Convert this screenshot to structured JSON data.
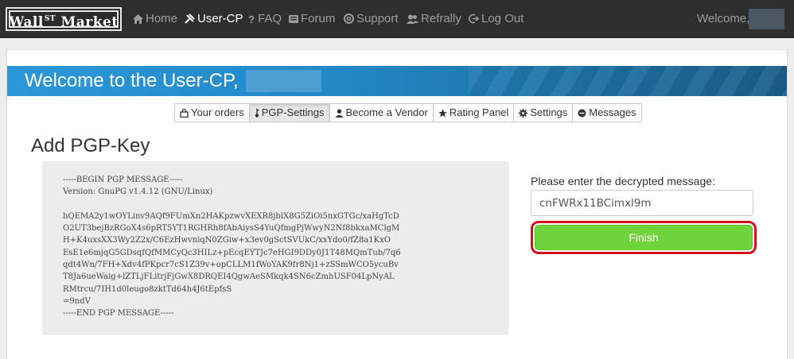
{
  "brand": {
    "main": "Wall",
    "sup": "ST",
    "rest": " Market"
  },
  "nav": {
    "items": [
      {
        "label": "Home",
        "icon": "home-icon"
      },
      {
        "label": "User-CP",
        "icon": "wrench-icon"
      },
      {
        "label": "FAQ",
        "icon": "question-icon"
      },
      {
        "label": "Forum",
        "icon": "forum-icon"
      },
      {
        "label": "Support",
        "icon": "lifebuoy-icon"
      },
      {
        "label": "Refrally",
        "icon": "users-icon"
      },
      {
        "label": "Log Out",
        "icon": "logout-icon"
      }
    ],
    "welcome": "Welcome,"
  },
  "banner": {
    "title": "Welcome to the User-CP,"
  },
  "tabs": [
    {
      "label": "Your orders",
      "icon": "shopping-bag-icon"
    },
    {
      "label": "PGP-Settings",
      "icon": "key-icon"
    },
    {
      "label": "Become a Vendor",
      "icon": "user-icon"
    },
    {
      "label": "Rating Panel",
      "icon": "star-icon"
    },
    {
      "label": "Settings",
      "icon": "gear-icon"
    },
    {
      "label": "Messages",
      "icon": "message-icon"
    }
  ],
  "page": {
    "heading": "Add PGP-Key"
  },
  "pgp_message": [
    "-----BEGIN PGP MESSAGE-----",
    "Version: GnuPG v1.4.12 (GNU/Linux)",
    "",
    "hQEMA2y1wOYLinv9AQf9FUmXn2HAKpzwvXEXR8jblX8G5ZiOi5nxGTGc/xaHgTcD",
    "O2UT3bejBzRGoX4s6pRT5YT1RGHRh8fAbAiysS4YuQfmgPjWwyN2Nf8bkxaMClgM",
    "H+K4uxsXX3Wy2Z2x/C6EzHwvniqN0ZGiw+x3ev0gSctSVUkC/xxYdo0/fZ8a1KxO",
    "EsE1e6mjqG5GDsqfQfMMCyQc3HILz+pEcqEYTJc7eHGI9DDy0J1T48MQmTub/7q6",
    "qdt4Wn/7FH+Xdv4fPKpcr7cS1Z39v+opCLLM1fWoYAK9fr8Nj1+zSSmWCO5ycuBv",
    "T8Ja6ueWaig+lZTLjFLitrjFjGwX8DRQEI4QgwAeSMkqk4SN6cZmhUSF04LpNyAL",
    "RMtrcu/7IH1d0leugo8zktTd64h4J6tEpfsS",
    "=9ndV",
    "-----END PGP MESSAGE-----"
  ],
  "form": {
    "label": "Please enter the decrypted message:",
    "value": "cnFWRx11BCimxl9m",
    "finish_label": "Finish"
  },
  "colors": {
    "navbar": "#2e2e2e",
    "banner": "#2389c7",
    "finish": "#6fd33b",
    "highlight": "#d6101a"
  }
}
